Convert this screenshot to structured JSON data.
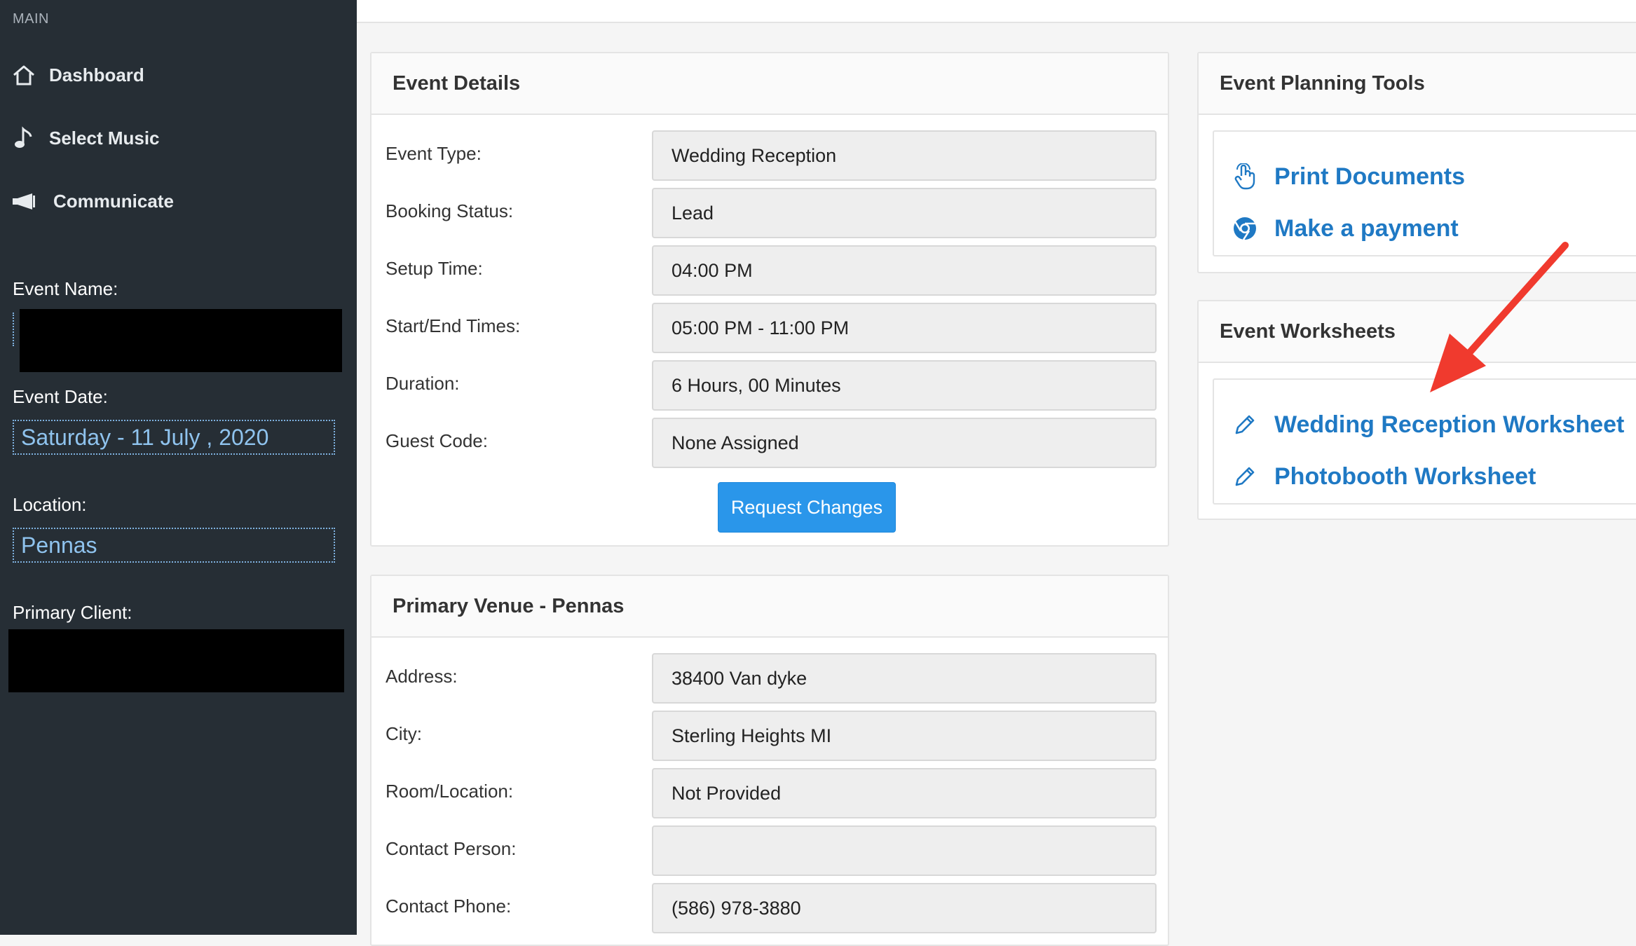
{
  "sidebar": {
    "section_label": "MAIN",
    "nav": [
      {
        "label": "Dashboard",
        "icon": "home-icon"
      },
      {
        "label": "Select Music",
        "icon": "music-note-icon"
      },
      {
        "label": "Communicate",
        "icon": "megaphone-icon"
      }
    ],
    "event_name_label": "Event Name:",
    "event_date_label": "Event Date:",
    "event_date_value": "Saturday - 11 July , 2020",
    "location_label": "Location:",
    "location_value": "Pennas",
    "primary_client_label": "Primary Client:"
  },
  "event_details": {
    "title": "Event Details",
    "rows": [
      {
        "label": "Event Type:",
        "value": "Wedding Reception"
      },
      {
        "label": "Booking Status:",
        "value": "Lead"
      },
      {
        "label": "Setup Time:",
        "value": "04:00 PM"
      },
      {
        "label": "Start/End Times:",
        "value": "05:00 PM - 11:00 PM"
      },
      {
        "label": "Duration:",
        "value": "6 Hours, 00 Minutes"
      },
      {
        "label": "Guest Code:",
        "value": "None Assigned"
      }
    ],
    "request_button": "Request Changes"
  },
  "primary_venue": {
    "title": "Primary Venue - Pennas",
    "rows": [
      {
        "label": "Address:",
        "value": "38400 Van dyke"
      },
      {
        "label": "City:",
        "value": "Sterling Heights MI"
      },
      {
        "label": "Room/Location:",
        "value": "Not Provided"
      },
      {
        "label": "Contact Person:",
        "value": ""
      },
      {
        "label": "Contact Phone:",
        "value": "(586) 978-3880"
      }
    ]
  },
  "planning_tools": {
    "title": "Event Planning Tools",
    "links": [
      {
        "label": "Print Documents",
        "icon": "hand-pointer-icon"
      },
      {
        "label": "Make a payment",
        "icon": "chrome-icon"
      }
    ]
  },
  "worksheets": {
    "title": "Event Worksheets",
    "links": [
      {
        "label": "Wedding Reception Worksheet",
        "icon": "pencil-icon"
      },
      {
        "label": "Photobooth Worksheet",
        "icon": "pencil-icon"
      }
    ]
  },
  "colors": {
    "sidebar_bg": "#262e35",
    "link_blue": "#1f79c4",
    "button_blue": "#2a96ea",
    "annotation_arrow": "#f03a2e"
  }
}
